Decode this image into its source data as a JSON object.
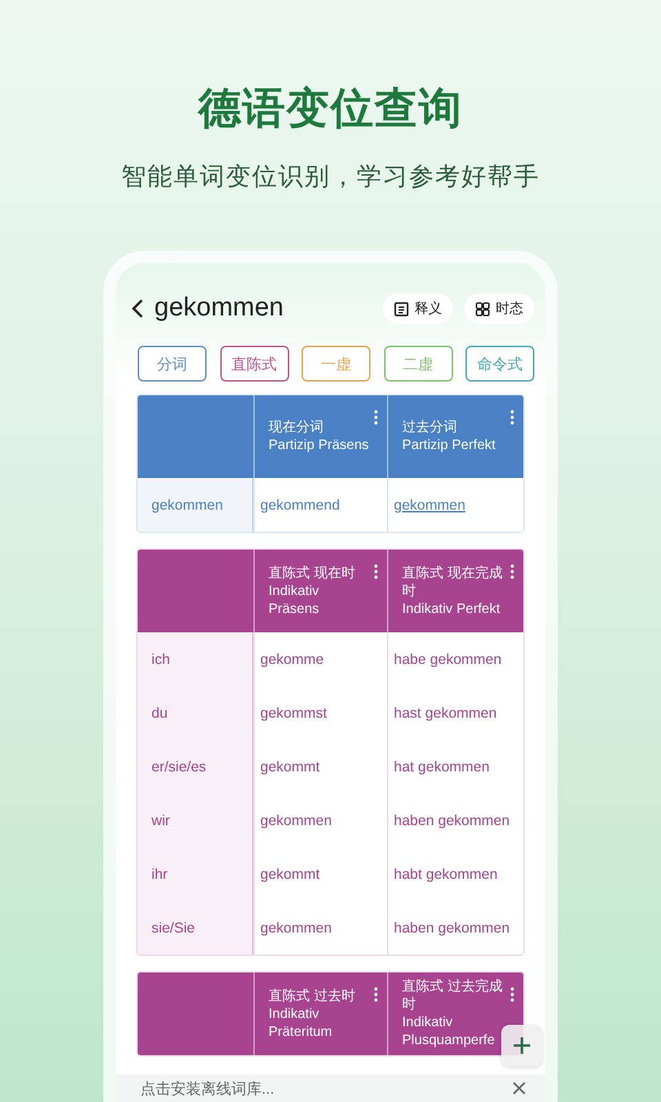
{
  "headline": "德语变位查询",
  "subheadline": "智能单词变位识别，学习参考好帮手",
  "app": {
    "word": "gekommen",
    "actions": [
      {
        "kind": "definition",
        "label": "释义"
      },
      {
        "kind": "tenses",
        "label": "时态"
      }
    ],
    "moods": [
      {
        "label": "分词",
        "color": "#5b8fc9"
      },
      {
        "label": "直陈式",
        "color": "#c2508f"
      },
      {
        "label": "一虚",
        "color": "#e8a04a"
      },
      {
        "label": "二虚",
        "color": "#7fc06a"
      },
      {
        "label": "命令式",
        "color": "#3fa9b5"
      }
    ],
    "tables": [
      {
        "color": "#4a80c4",
        "columns": [
          {
            "zh": "现在分词",
            "de": "Partizip Präsens"
          },
          {
            "zh": "过去分词",
            "de": "Partizip Perfekt"
          }
        ],
        "rows": [
          {
            "label": "gekommen",
            "cells": [
              {
                "text": "gekommend",
                "link": false
              },
              {
                "text": "gekommen",
                "link": true
              }
            ]
          }
        ]
      },
      {
        "color": "#a8438f",
        "columns": [
          {
            "zh": "直陈式 现在时",
            "de": "Indikativ Präsens"
          },
          {
            "zh": "直陈式 现在完成时",
            "de": "Indikativ Perfekt"
          }
        ],
        "rows": [
          {
            "label": "ich",
            "cells": [
              {
                "text": "gekomme",
                "link": false
              },
              {
                "text": "habe gekommen",
                "link": false
              }
            ]
          },
          {
            "label": "du",
            "cells": [
              {
                "text": "gekommst",
                "link": false
              },
              {
                "text": "hast gekommen",
                "link": false
              }
            ]
          },
          {
            "label": "er/sie/es",
            "cells": [
              {
                "text": "gekommt",
                "link": false
              },
              {
                "text": "hat gekommen",
                "link": false
              }
            ]
          },
          {
            "label": "wir",
            "cells": [
              {
                "text": "gekommen",
                "link": false
              },
              {
                "text": "haben gekommen",
                "link": false
              }
            ]
          },
          {
            "label": "ihr",
            "cells": [
              {
                "text": "gekommt",
                "link": false
              },
              {
                "text": "habt gekommen",
                "link": false
              }
            ]
          },
          {
            "label": "sie/Sie",
            "cells": [
              {
                "text": "gekommen",
                "link": false
              },
              {
                "text": "haben gekommen",
                "link": false
              }
            ]
          }
        ]
      },
      {
        "color": "#a8438f",
        "columns": [
          {
            "zh": "直陈式 过去时",
            "de": "Indikativ Präteritum"
          },
          {
            "zh": "直陈式 过去完成时",
            "de": "Indikativ Plusquamperfe"
          }
        ]
      }
    ],
    "banner": {
      "text": "点击安装离线词库..."
    }
  }
}
